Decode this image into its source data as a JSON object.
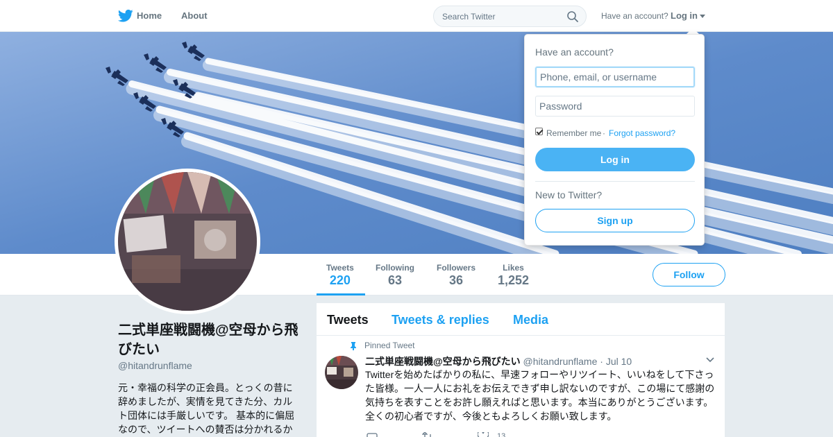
{
  "nav": {
    "home_label": "Home",
    "about_label": "About",
    "search_placeholder": "Search Twitter",
    "have_account_label": "Have an account?",
    "login_label": "Log in",
    "brand_color": "#1da1f2"
  },
  "profile": {
    "name": "二式単座戦闘機@空母から飛びたい",
    "handle": "@hitandrunflame",
    "bio": "元・幸福の科学の正会員。とっくの昔に辞めましたが、実情を見てきた分、カルト団体には手厳しいです。 基本的に偏屈なので、ツイートへの賛否は分かれるか"
  },
  "stats": [
    {
      "label": "Tweets",
      "value": "220"
    },
    {
      "label": "Following",
      "value": "63"
    },
    {
      "label": "Followers",
      "value": "36"
    },
    {
      "label": "Likes",
      "value": "1,252"
    }
  ],
  "follow_label": "Follow",
  "timeline": {
    "tabs": [
      "Tweets",
      "Tweets & replies",
      "Media"
    ],
    "pinned_label": "Pinned Tweet",
    "tweet": {
      "name": "二式単座戦闘機@空母から飛びたい",
      "handle": "@hitandrunflame",
      "separator": "·",
      "date": "Jul 10",
      "text": "Twitterを始めたばかりの私に、早速フォローやリツイート、いいねをして下さった皆様。一人一人にお礼をお伝えできず申し訳ないのですが、この場にて感謝の気持ちを表すことをお許し願えればと思います。本当にありがとうございます。全くの初心者ですが、今後ともよろしくお願い致します。",
      "like_count": "13"
    }
  },
  "login_dropdown": {
    "title": "Have an account?",
    "username_placeholder": "Phone, email, or username",
    "password_placeholder": "Password",
    "remember_label": "Remember me",
    "separator": "·",
    "forgot_label": "Forgot password?",
    "login_button": "Log in",
    "new_label": "New to Twitter?",
    "signup_button": "Sign up"
  }
}
